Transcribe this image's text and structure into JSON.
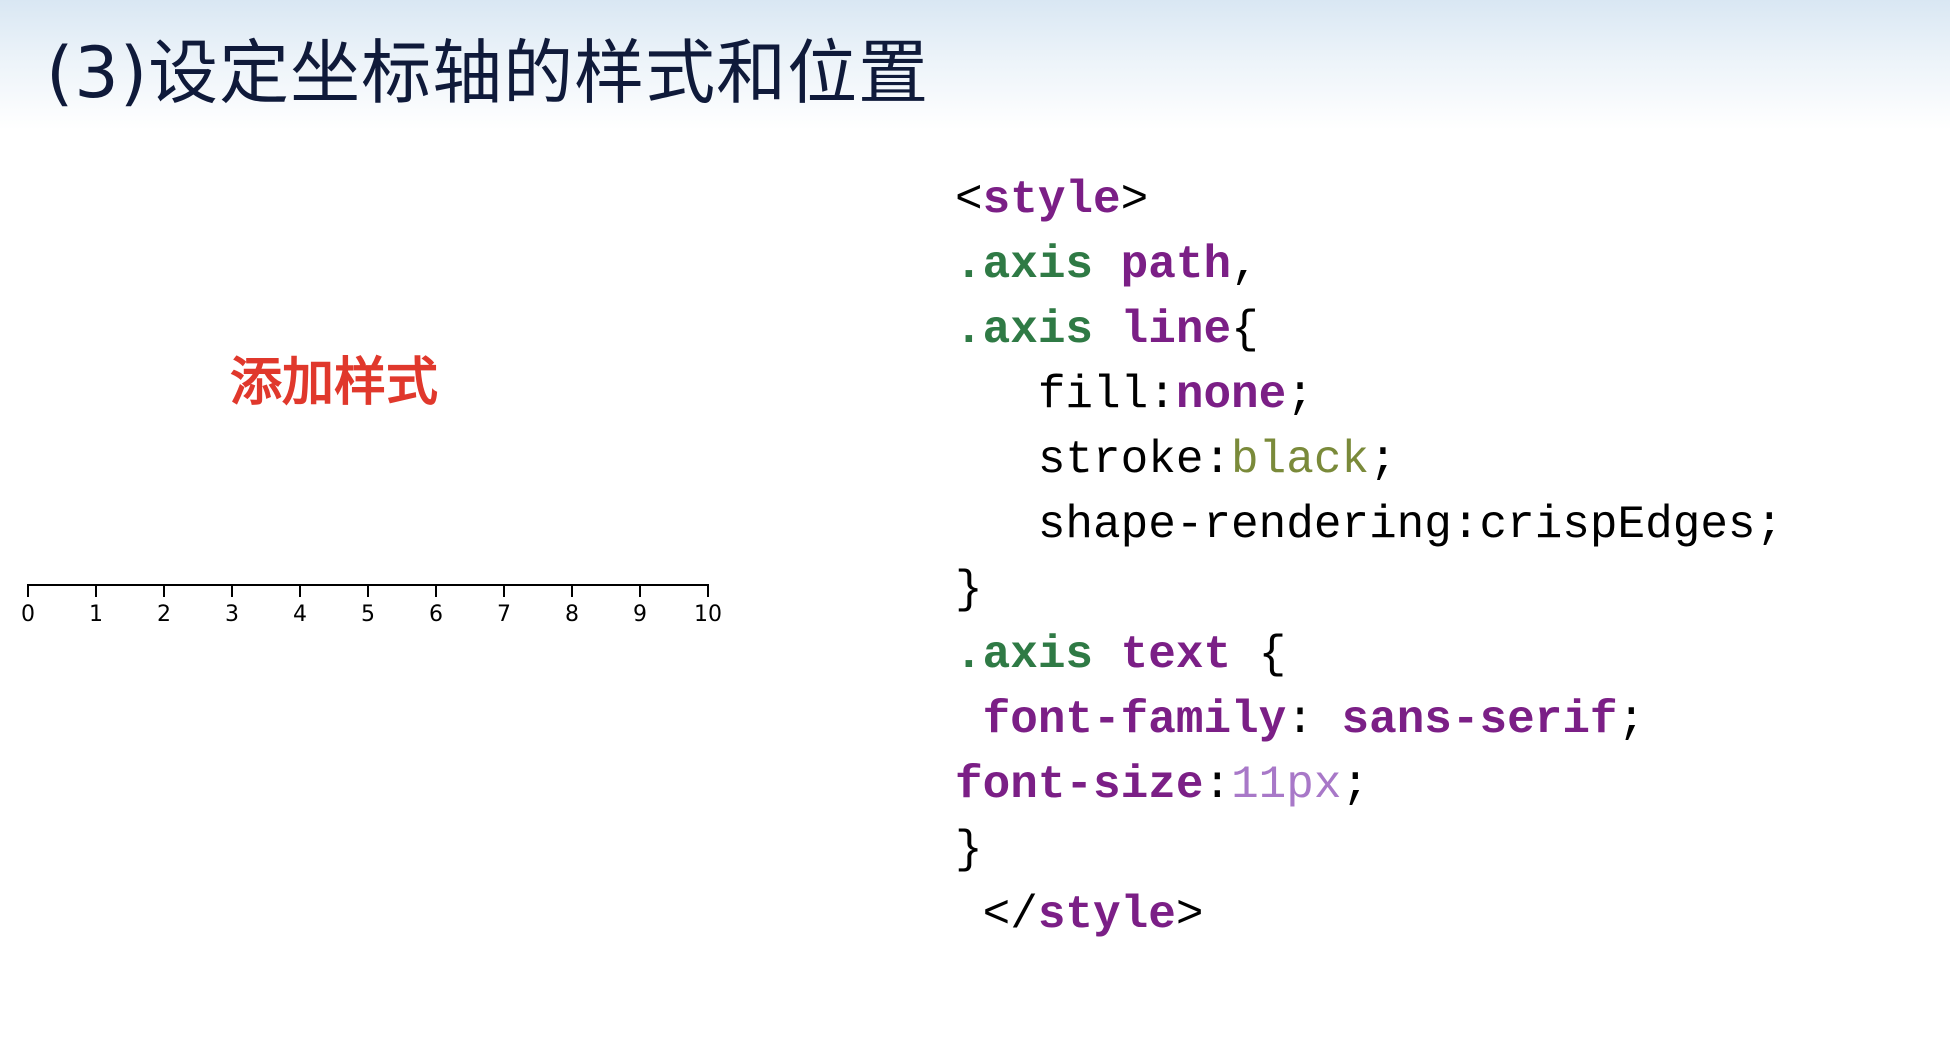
{
  "slide": {
    "title": "(3)设定坐标轴的样式和位置",
    "note_label": "添加样式"
  },
  "axis_figure": {
    "domain": [
      0,
      10
    ],
    "tick_labels": [
      "0",
      "1",
      "2",
      "3",
      "4",
      "5",
      "6",
      "7",
      "8",
      "9",
      "10"
    ]
  },
  "code": {
    "lines": [
      [
        {
          "t": "<",
          "c": "plain"
        },
        {
          "t": "style",
          "c": "kw"
        },
        {
          "t": ">",
          "c": "plain"
        }
      ],
      [
        {
          "t": ".axis",
          "c": "sel"
        },
        {
          "t": " ",
          "c": "plain"
        },
        {
          "t": "path",
          "c": "kw"
        },
        {
          "t": ",",
          "c": "plain"
        }
      ],
      [
        {
          "t": ".axis",
          "c": "sel"
        },
        {
          "t": " ",
          "c": "plain"
        },
        {
          "t": "line",
          "c": "kw"
        },
        {
          "t": "{",
          "c": "plain"
        }
      ],
      [
        {
          "t": "   fill:",
          "c": "plain"
        },
        {
          "t": "none",
          "c": "kw"
        },
        {
          "t": ";",
          "c": "plain"
        }
      ],
      [
        {
          "t": "   stroke:",
          "c": "plain"
        },
        {
          "t": "black",
          "c": "olive"
        },
        {
          "t": ";",
          "c": "plain"
        }
      ],
      [
        {
          "t": "   shape-rendering:crispEdges;",
          "c": "plain"
        }
      ],
      [
        {
          "t": "}",
          "c": "plain"
        }
      ],
      [
        {
          "t": ".axis",
          "c": "sel"
        },
        {
          "t": " ",
          "c": "plain"
        },
        {
          "t": "text",
          "c": "kw"
        },
        {
          "t": " {",
          "c": "plain"
        }
      ],
      [
        {
          "t": " ",
          "c": "plain"
        },
        {
          "t": "font-family",
          "c": "kw"
        },
        {
          "t": ": ",
          "c": "plain"
        },
        {
          "t": "sans-serif",
          "c": "kw"
        },
        {
          "t": ";",
          "c": "plain"
        }
      ],
      [
        {
          "t": "font-size",
          "c": "kw"
        },
        {
          "t": ":",
          "c": "plain"
        },
        {
          "t": "11px",
          "c": "num"
        },
        {
          "t": ";",
          "c": "plain"
        }
      ],
      [
        {
          "t": "}",
          "c": "plain"
        }
      ],
      [
        {
          "t": " </",
          "c": "plain"
        },
        {
          "t": "style",
          "c": "kw"
        },
        {
          "t": ">",
          "c": "plain"
        }
      ]
    ]
  },
  "colors": {
    "title": "#0f1a3a",
    "note_label": "#e0382c",
    "keyword": "#7b1f86",
    "selector": "#2f7a45",
    "value_olive": "#7a8a3a",
    "number": "#a878c8"
  }
}
